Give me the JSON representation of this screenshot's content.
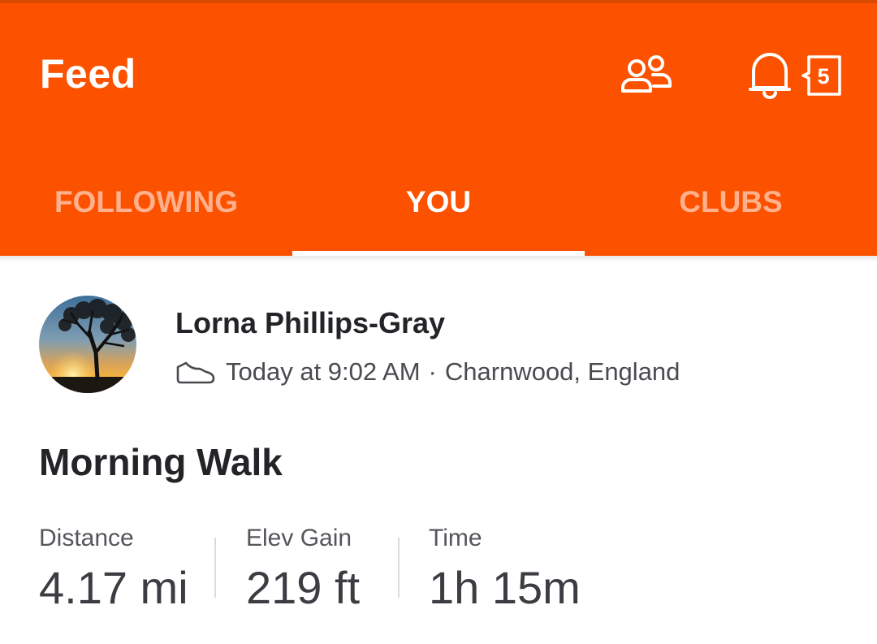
{
  "header": {
    "title": "Feed",
    "people_icon": "people-icon",
    "bell_icon": "bell-icon",
    "notification_count": "5",
    "background": "#fc5200"
  },
  "tabs": [
    {
      "label": "FOLLOWING",
      "active": false
    },
    {
      "label": "YOU",
      "active": true
    },
    {
      "label": "CLUBS",
      "active": false
    }
  ],
  "activity": {
    "athlete_name": "Lorna Phillips-Gray",
    "sport_icon": "shoe-icon",
    "timestamp": "Today at 9:02 AM",
    "separator": "·",
    "location": "Charnwood, England",
    "title": "Morning Walk",
    "stats": [
      {
        "label": "Distance",
        "value": "4.17 mi"
      },
      {
        "label": "Elev Gain",
        "value": "219 ft"
      },
      {
        "label": "Time",
        "value": "1h 15m"
      }
    ]
  }
}
